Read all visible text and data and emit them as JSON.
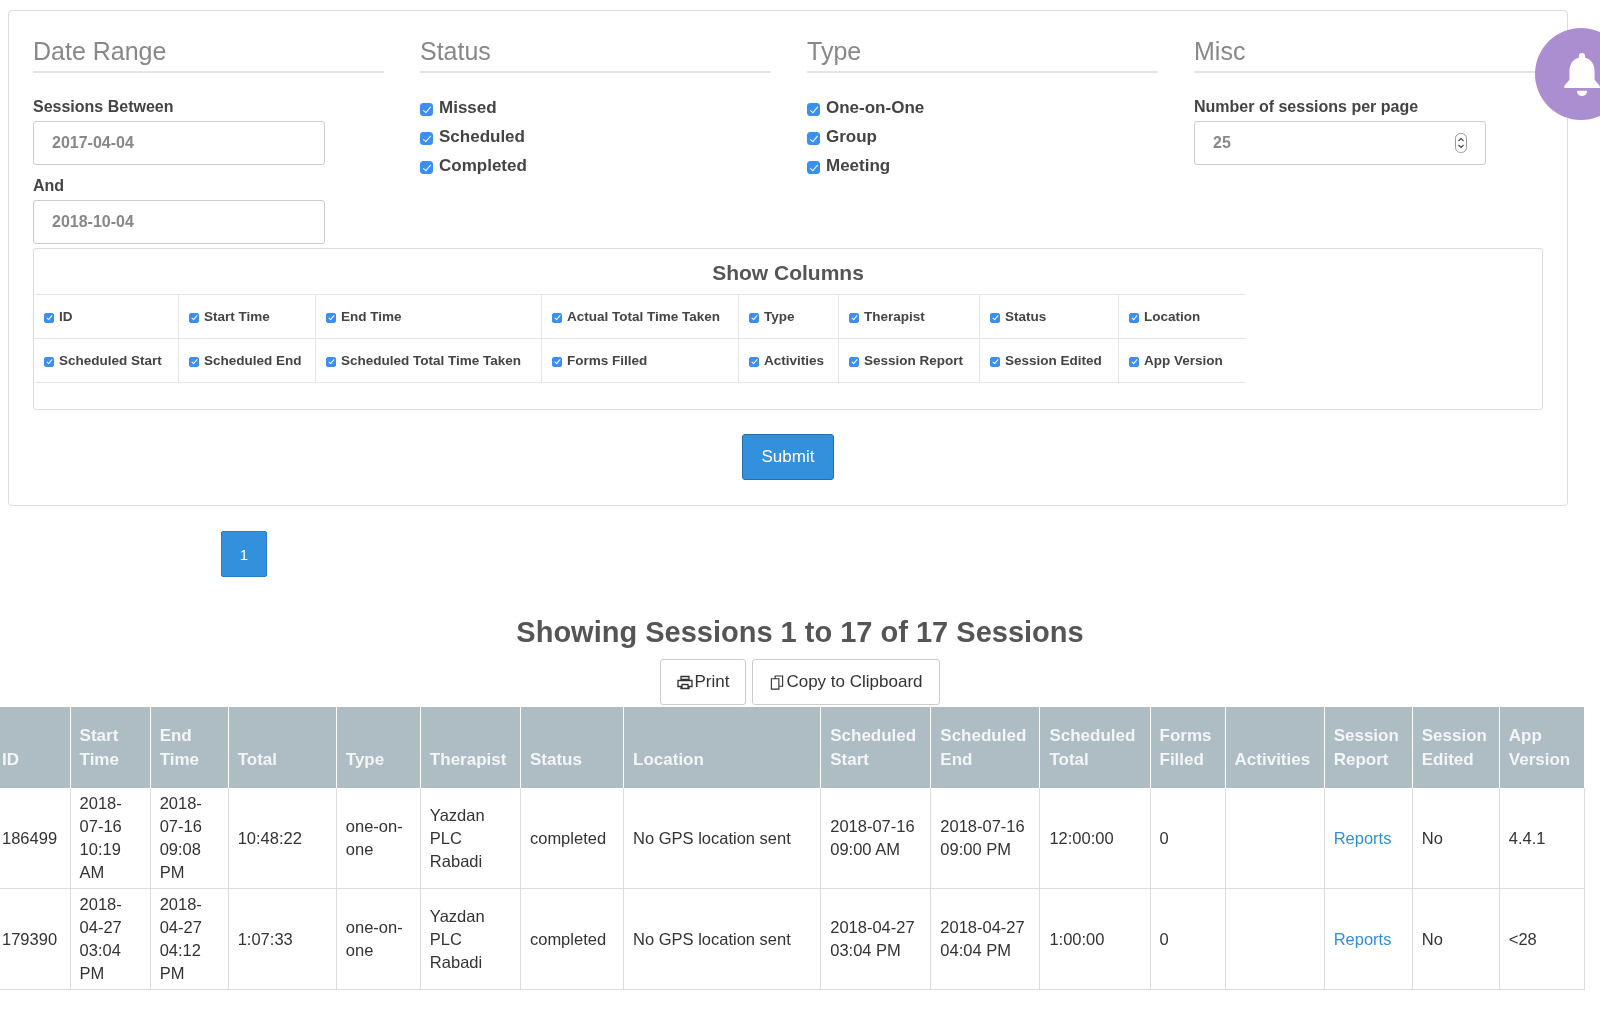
{
  "filters": {
    "date_range": {
      "heading": "Date Range",
      "from_label": "Sessions Between",
      "from_value": "2017-04-04",
      "to_label": "And",
      "to_value": "2018-10-04"
    },
    "status": {
      "heading": "Status",
      "options": [
        {
          "label": "Missed",
          "checked": true
        },
        {
          "label": "Scheduled",
          "checked": true
        },
        {
          "label": "Completed",
          "checked": true
        }
      ]
    },
    "type": {
      "heading": "Type",
      "options": [
        {
          "label": "One-on-One",
          "checked": true
        },
        {
          "label": "Group",
          "checked": true
        },
        {
          "label": "Meeting",
          "checked": true
        }
      ]
    },
    "misc": {
      "heading": "Misc",
      "per_page_label": "Number of sessions per page",
      "per_page_value": "25"
    },
    "show_columns": {
      "title": "Show Columns",
      "rows": [
        [
          {
            "label": "ID",
            "checked": true
          },
          {
            "label": "Start Time",
            "checked": true
          },
          {
            "label": "End Time",
            "checked": true
          },
          {
            "label": "Actual Total Time Taken",
            "checked": true
          },
          {
            "label": "Type",
            "checked": true
          },
          {
            "label": "Therapist",
            "checked": true
          },
          {
            "label": "Status",
            "checked": true
          },
          {
            "label": "Location",
            "checked": true
          }
        ],
        [
          {
            "label": "Scheduled Start",
            "checked": true
          },
          {
            "label": "Scheduled End",
            "checked": true
          },
          {
            "label": "Scheduled Total Time Taken",
            "checked": true
          },
          {
            "label": "Forms Filled",
            "checked": true
          },
          {
            "label": "Activities",
            "checked": true
          },
          {
            "label": "Session Report",
            "checked": true
          },
          {
            "label": "Session Edited",
            "checked": true
          },
          {
            "label": "App Version",
            "checked": true
          }
        ]
      ]
    },
    "submit": "Submit"
  },
  "pagination": [
    {
      "label": "1",
      "selected": true
    }
  ],
  "results_title": "Showing Sessions 1 to 17 of 17 Sessions",
  "actions": [
    {
      "kind": "print",
      "label": "Print"
    },
    {
      "kind": "copy",
      "label": "Copy to Clipboard"
    }
  ],
  "table": {
    "columns": [
      "ID",
      "Start Time",
      "End Time",
      "Total",
      "Type",
      "Therapist",
      "Status",
      "Location",
      "Scheduled Start",
      "Scheduled End",
      "Scheduled Total",
      "Forms Filled",
      "Activities",
      "Session Report",
      "Session Edited",
      "App Version"
    ],
    "rows": [
      [
        "186499",
        "2018-07-16 10:19 AM",
        "2018-07-16 09:08 PM",
        "10:48:22",
        "one-on-one",
        "Yazdan PLC Rabadi",
        "completed",
        "No GPS location sent",
        "2018-07-16 09:00 AM",
        "2018-07-16 09:00 PM",
        "12:00:00",
        "0",
        "",
        "Reports",
        "No",
        "4.4.1"
      ],
      [
        "179390",
        "2018-04-27 03:04 PM",
        "2018-04-27 04:12 PM",
        "1:07:33",
        "one-on-one",
        "Yazdan PLC Rabadi",
        "completed",
        "No GPS location sent",
        "2018-04-27 03:04 PM",
        "2018-04-27 04:04 PM",
        "1:00:00",
        "0",
        "",
        "Reports",
        "No",
        "<28"
      ]
    ]
  }
}
